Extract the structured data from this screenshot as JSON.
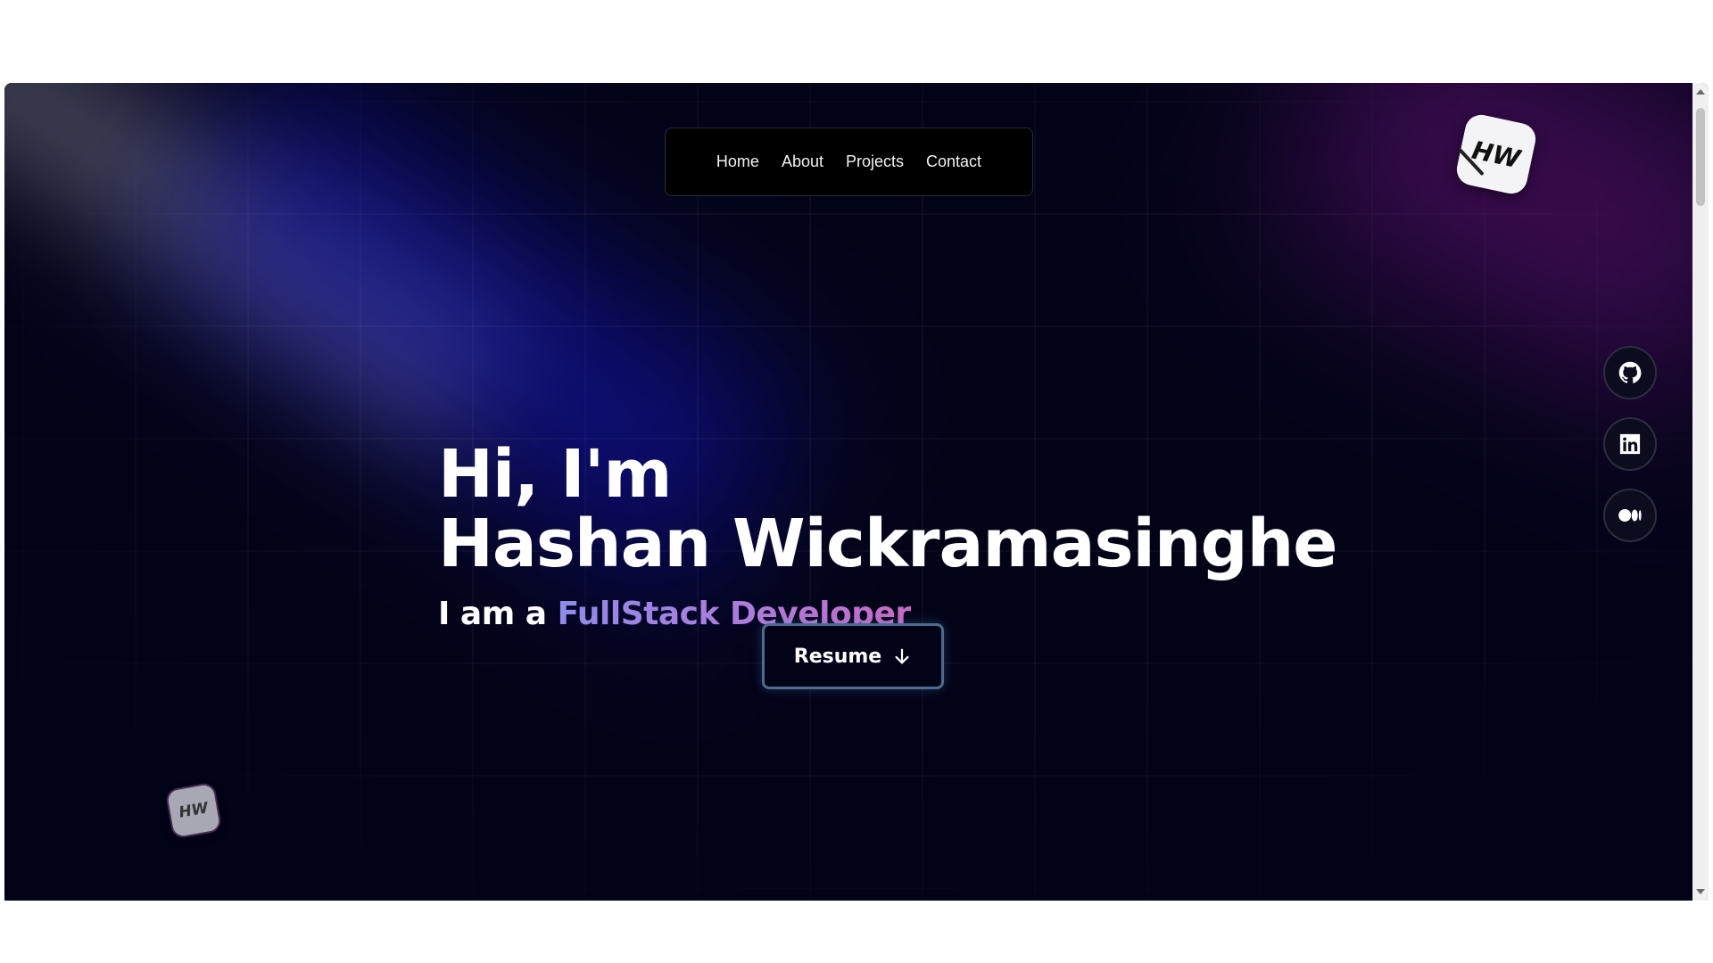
{
  "nav": {
    "items": [
      {
        "label": "Home"
      },
      {
        "label": "About"
      },
      {
        "label": "Projects"
      },
      {
        "label": "Contact"
      }
    ]
  },
  "logo": {
    "text": "HW"
  },
  "hero": {
    "greeting": "Hi, I'm",
    "name": "Hashan Wickramasinghe",
    "subtitle_prefix": "I am a",
    "role": "FullStack Developer"
  },
  "resume_button": {
    "label": "Resume",
    "icon": "arrow-down-icon"
  },
  "social": [
    {
      "name": "GitHub",
      "icon": "github-icon"
    },
    {
      "name": "LinkedIn",
      "icon": "linkedin-icon"
    },
    {
      "name": "Medium",
      "icon": "medium-icon"
    }
  ],
  "colors": {
    "background": "#030318",
    "role_gradient_start": "#8f8be8",
    "role_gradient_end": "#c86bc6",
    "button_border": "#4d6b8f"
  }
}
